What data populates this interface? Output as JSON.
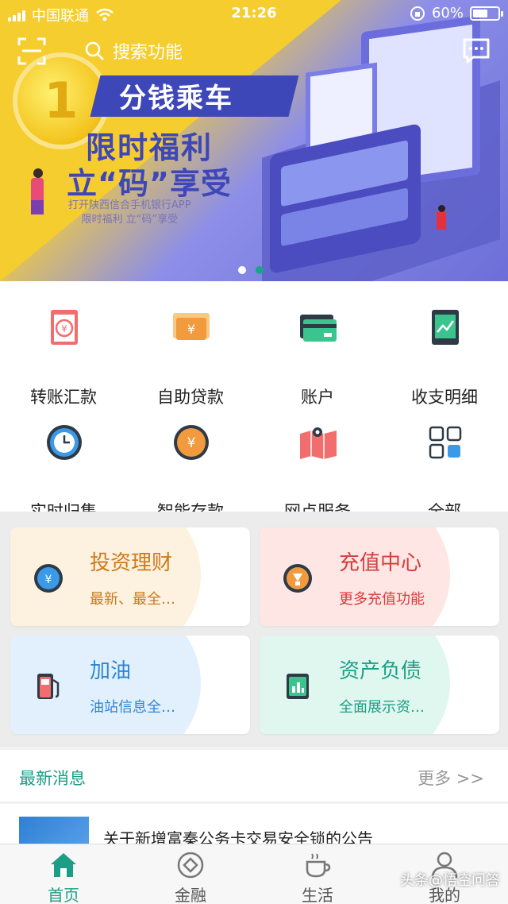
{
  "status_bar": {
    "carrier": "中国联通",
    "time": "21:26",
    "battery_text": "60%",
    "battery_level": 0.6
  },
  "header": {
    "search_placeholder": "搜索功能",
    "icons": [
      "scan-icon",
      "search-icon",
      "message-icon"
    ]
  },
  "banner": {
    "coin_text": "1",
    "headline": "分钱乘车",
    "line2": "限时福利",
    "line3": "立“码”享受",
    "sub1": "打开陕西信合手机银行APP",
    "sub2": "限时福利 立“码”享受",
    "slides": 2,
    "active_slide": 2
  },
  "quick_actions": [
    {
      "label": "转账汇款",
      "icon": "transfer-icon"
    },
    {
      "label": "自助贷款",
      "icon": "loan-icon"
    },
    {
      "label": "账户",
      "icon": "card-icon"
    },
    {
      "label": "收支明细",
      "icon": "chart-icon"
    },
    {
      "label": "实时归集",
      "icon": "clock-icon"
    },
    {
      "label": "智能存款",
      "icon": "deposit-icon"
    },
    {
      "label": "网点服务",
      "icon": "map-icon"
    },
    {
      "label": "全部",
      "icon": "grid-icon"
    }
  ],
  "cards": [
    {
      "title": "投资理财",
      "subtitle": "最新、最全…",
      "icon": "yuan-icon",
      "title_color": "#d07a18",
      "sub_color": "#c77a1e",
      "bg": "#fdf1e0"
    },
    {
      "title": "充值中心",
      "subtitle": "更多充值功能",
      "icon": "recharge-icon",
      "title_color": "#d93b3b",
      "sub_color": "#d93b3b",
      "bg": "#fde6e4"
    },
    {
      "title": "加油",
      "subtitle": "油站信息全…",
      "icon": "fuel-icon",
      "title_color": "#2b86d6",
      "sub_color": "#2b86d6",
      "bg": "#e2f0fd"
    },
    {
      "title": "资产负债",
      "subtitle": "全面展示资…",
      "icon": "asset-icon",
      "title_color": "#1b9e86",
      "sub_color": "#1b9e86",
      "bg": "#e0f7ef"
    }
  ],
  "news": {
    "title": "最新消息",
    "more": "更多 >>",
    "items": [
      {
        "text": "关于新增富秦公务卡交易安全锁的公告"
      }
    ]
  },
  "tabbar": [
    {
      "label": "首页",
      "icon": "home-icon",
      "active": true
    },
    {
      "label": "金融",
      "icon": "finance-icon",
      "active": false
    },
    {
      "label": "生活",
      "icon": "coffee-icon",
      "active": false
    },
    {
      "label": "我的",
      "icon": "user-icon",
      "active": false
    }
  ],
  "watermark": "头条@悟空问答",
  "colors": {
    "accent": "#1b9e86",
    "banner_yellow": "#f6cd2f",
    "banner_purple": "#6d6fd8"
  }
}
